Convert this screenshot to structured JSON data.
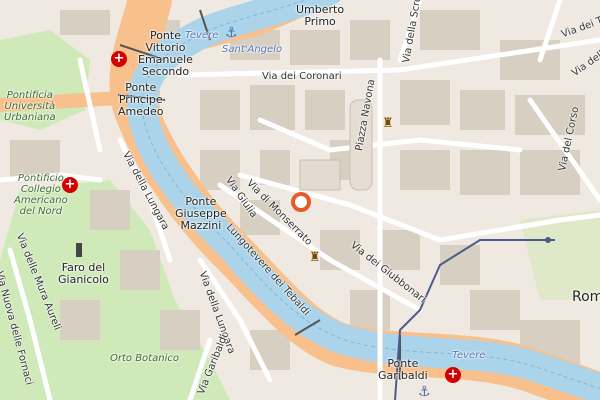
{
  "map": {
    "colors": {
      "land": "#efe9e1",
      "block": "#d8cfc3",
      "river": "#abd4ea",
      "riverbank": "#aad3df",
      "lungotevere": "#f8c08c",
      "street": "#ffffff",
      "park": "#cfe9b9",
      "hospital": "#d40000",
      "marker": "#e85a2a",
      "tram": "#4b5c8a"
    },
    "labels": {
      "umberto_primo": "Umberto\nPrimo",
      "tevere_north": "Tevere",
      "sant_angelo": "Sant'Angelo",
      "ponte_vittorio": "Ponte\nVittorio\nEmanuele\nSecondo",
      "ponte_principe": "Ponte\nPrincipe\nAmedeo",
      "pontificia_urbaniana": "Pontificia\nUniversità\nUrbaniana",
      "via_dei_coronari": "Via dei Coronari",
      "piazza_navona": "Piazza Navona",
      "via_della_scrofa": "Via della Scrofa",
      "via_dei_triton": "Via dei Trito",
      "via_del_corso": "Via del Corso",
      "via_delle_vite": "Via delle Vite",
      "pontificio_collegio": "Pontificio\nCollegio\nAmericano\ndel Nord",
      "via_della_lungara_north": "Via della Lungara",
      "via_giulia": "Via Giulia",
      "via_di_monserrato": "Via di Monserrato",
      "ponte_giuseppe_mazzini": "Ponte\nGiuseppe\nMazzini",
      "lungotevere_tebaldi": "Lungotevere dei Tebaldi",
      "via_dei_giubbonari": "Via dei Giubbonari",
      "faro_gianicolo": "Faro del\nGianicolo",
      "via_mura_aureli": "Via delle Mura Aureli",
      "via_nuova_fornaci": "Via Nuova delle Fornaci",
      "via_della_lungara_south": "Via della Lungara",
      "orto_botanico": "Orto Botanico",
      "via_garibaldi": "Via Garibaldi",
      "ponte_garibaldi": "Ponte\nGaribaldi",
      "tevere_south": "Tevere",
      "roma": "Rom"
    }
  }
}
